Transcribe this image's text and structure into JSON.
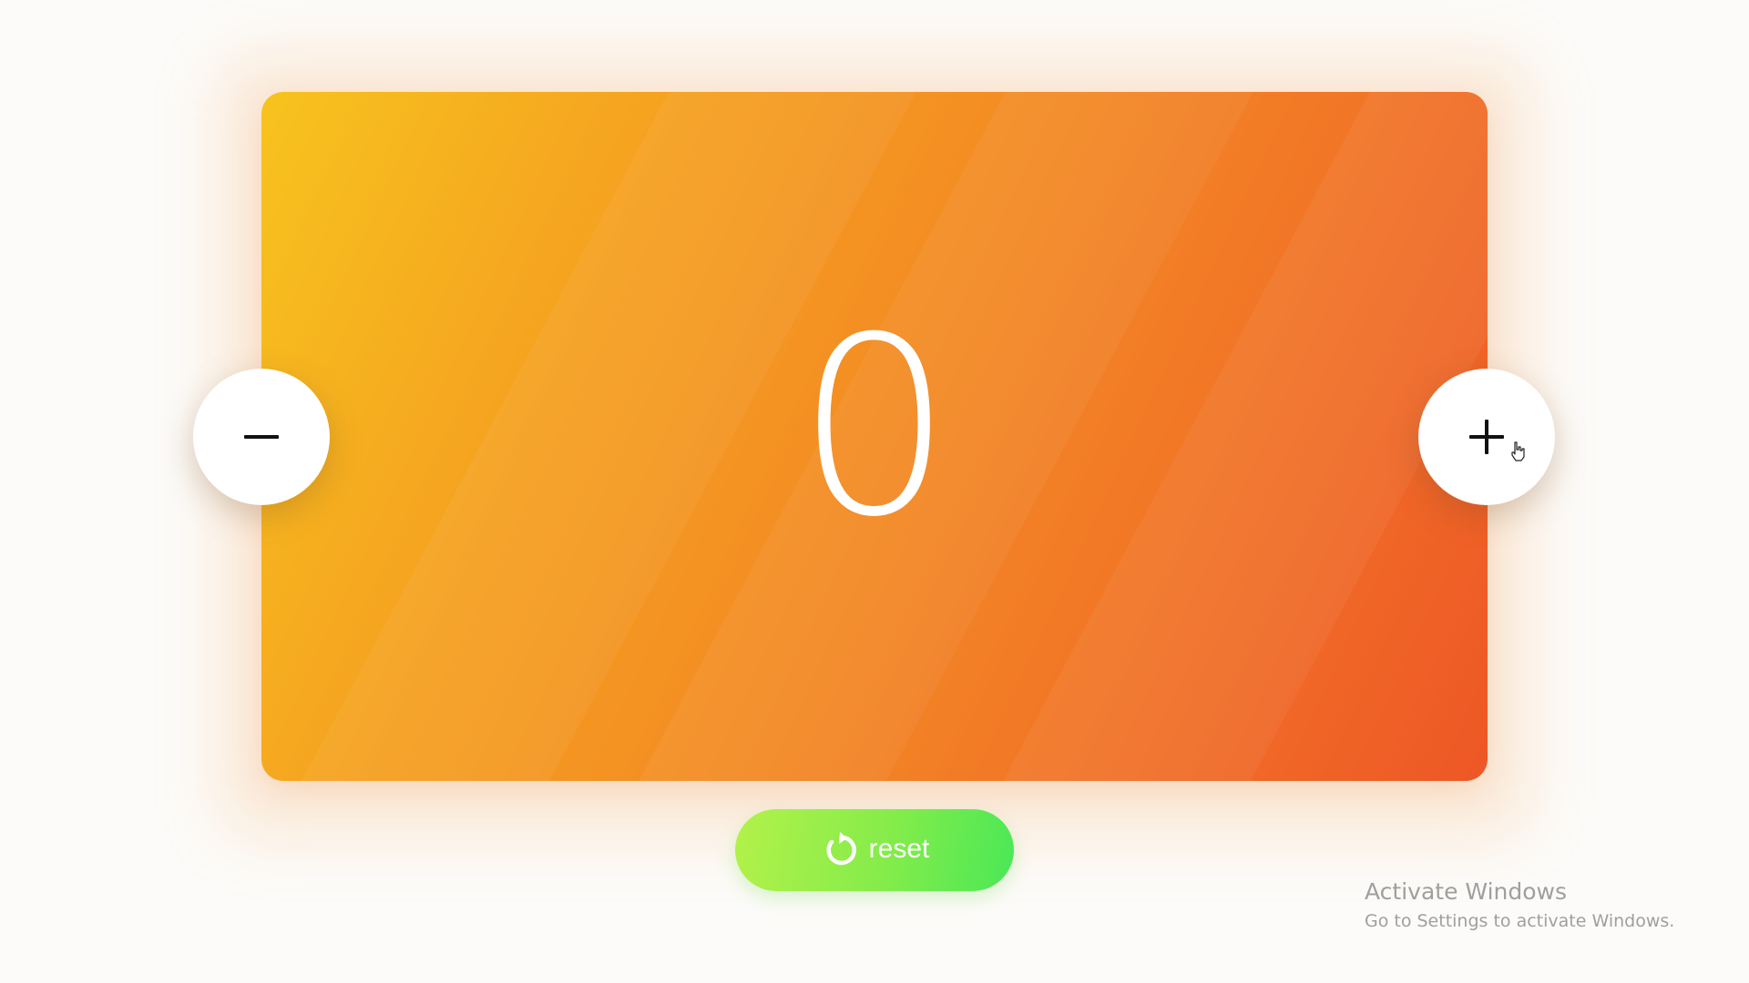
{
  "counter": {
    "value": "0",
    "card_colors": [
      "#f7c31e",
      "#f5a020",
      "#f38a24",
      "#f17227",
      "#ee5726"
    ]
  },
  "controls": {
    "decrement_icon": "minus-icon",
    "increment_icon": "plus-icon",
    "reset_icon": "reset-icon",
    "reset_label": "reset",
    "reset_colors": [
      "#b4f14a",
      "#4ae857"
    ]
  },
  "cursor": {
    "icon": "hand-pointer-icon"
  },
  "watermark": {
    "title": "Activate Windows",
    "subtitle": "Go to Settings to activate Windows."
  }
}
